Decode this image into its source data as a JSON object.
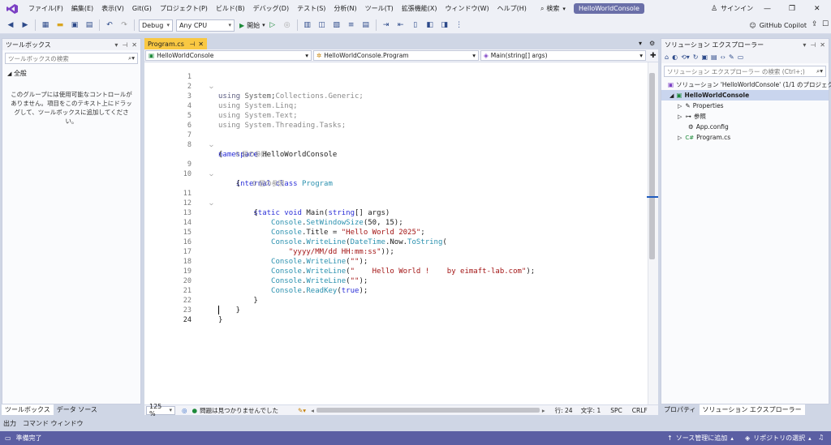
{
  "menu": {
    "items": [
      "ファイル(F)",
      "編集(E)",
      "表示(V)",
      "Git(G)",
      "プロジェクト(P)",
      "ビルド(B)",
      "デバッグ(D)",
      "テスト(S)",
      "分析(N)",
      "ツール(T)",
      "拡張機能(X)",
      "ウィンドウ(W)",
      "ヘルプ(H)"
    ],
    "search_label": "検索",
    "solution_title": "HelloWorldConsole",
    "signin": "サインイン"
  },
  "toolbar": {
    "config": "Debug",
    "platform": "Any CPU",
    "start_label": "開始",
    "copilot": "GitHub Copilot"
  },
  "toolbox": {
    "title": "ツールボックス",
    "search_placeholder": "ツールボックスの検索",
    "group": "全般",
    "empty_message": "このグループには使用可能なコントロールがありません。項目をこのテキスト上にドラッグして、ツールボックスに追加してください。",
    "tab_toolbox": "ツールボックス",
    "tab_datasource": "データ ソース"
  },
  "editor": {
    "tab_name": "Program.cs",
    "nav_project": "HelloWorldConsole",
    "nav_class": "HelloWorldConsole.Program",
    "nav_member": "Main(string[] args)",
    "ref_count_1": "0 個の参照",
    "ref_count_2": "0 個の参照",
    "line_numbers": [
      "1",
      "2",
      "3",
      "4",
      "5",
      "6",
      "7",
      "8",
      "9",
      "10",
      "11",
      "12",
      "13",
      "14",
      "15",
      "16",
      "17",
      "18",
      "19",
      "20",
      "21",
      "22",
      "23",
      "24"
    ]
  },
  "status_line": {
    "zoom": "125 %",
    "issues": "問題は見つかりませんでした",
    "line": "行: 24",
    "char": "文字: 1",
    "spc": "SPC",
    "crlf": "CRLF"
  },
  "solution_explorer": {
    "title": "ソリューション エクスプローラー",
    "search_placeholder": "ソリューション エクスプローラー の検索 (Ctrl+;)",
    "solution": "ソリューション 'HelloWorldConsole' (1/1 のプロジェクト)",
    "project": "HelloWorldConsole",
    "items": [
      "Properties",
      "参照",
      "App.config",
      "Program.cs"
    ],
    "tab_properties": "プロパティ",
    "tab_solexp": "ソリューション エクスプローラー"
  },
  "bottom_tabs": [
    "出力",
    "コマンド ウィンドウ"
  ],
  "statusbar": {
    "ready": "準備完了",
    "source_control": "ソース管理に追加",
    "repository": "リポジトリの選択"
  },
  "colors": {
    "accent": "#5b5fa3",
    "tab_active": "#f9c842",
    "keyword": "#2b2fd8",
    "type": "#2b91af",
    "string": "#a31515"
  }
}
